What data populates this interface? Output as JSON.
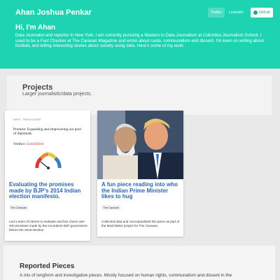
{
  "header": {
    "brand": "Ahan Joshua Penkar",
    "nav": {
      "twitter": "Twitter",
      "linkedin": "LinkedIn",
      "github": "Github"
    },
    "greeting": "Hi, I'm Ahan",
    "bio": "Data Journalist and reporter in New York. I am currently pursuing a Masters in Data Journalism at Columbia Journalism School. I used to be a Fact Checker at The Caravan Magazine and wrote about caste, communalism and dissent. I'm keen on writing about football, and telling interesting stories about society using data. Here's some of my work."
  },
  "projects": {
    "title": "Projects",
    "subtitle": "Larger journalistic/data projects.",
    "cards": [
      {
        "thumb_small": "MAPS · TRANSLATIONS",
        "thumb_headline": "Promise: Expanding and empowering our pool of diplomats.",
        "thumb_verdict_label": "Verdict:",
        "thumb_verdict_value": "Unfulfilled",
        "title": "Evaluating the promises made by BJP's 2014 Indian election manifesto.",
        "tag": "The Caravan",
        "description": "Led a team of interns to evaluate and fact check over 400 promises made by the incumbent BJP government before the 2019 election."
      },
      {
        "title": "A fun piece reading into who the Indian Prime Minister likes to hug",
        "tag": "The Caravan",
        "description": "Collected data and conceptualized this piece as part of the Modi Meter project for The Caravan."
      }
    ]
  },
  "reported": {
    "title": "Reported Pieces",
    "subtitle": "A mix of longform and investigative pieces. Mostly focused on human rights, communalism and dissent in the"
  },
  "colors": {
    "accent": "#1ed3b1",
    "link": "#2a66b3"
  }
}
